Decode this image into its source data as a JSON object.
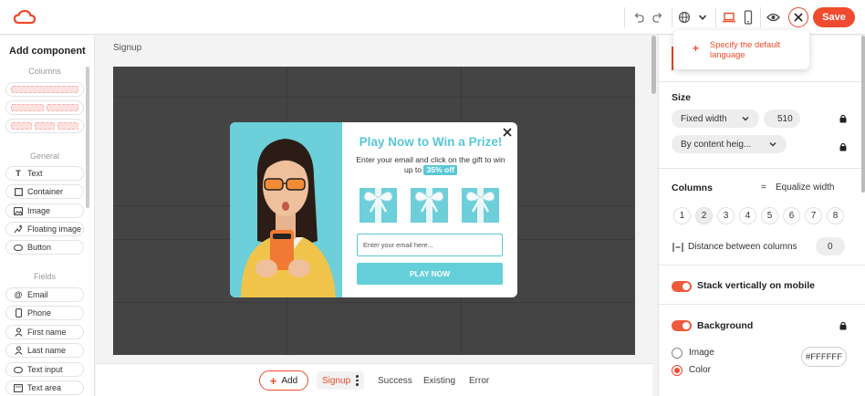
{
  "colors": {
    "accent": "#ef4b2e",
    "popup_accent": "#58c7d6",
    "canvas_bg": "#444444"
  },
  "topbar": {
    "save_label": "Save",
    "icons": [
      "logo-icon",
      "undo-icon",
      "redo-icon",
      "globe-icon",
      "chevron-down-icon",
      "laptop-icon",
      "mobile-icon",
      "eye-icon",
      "close-icon"
    ]
  },
  "language_dropdown": {
    "add_label": "Specify the default language"
  },
  "left_panel": {
    "title": "Add component",
    "sections": {
      "columns": "Columns",
      "general": "General",
      "fields": "Fields"
    },
    "general_items": [
      {
        "label": "Text",
        "icon": "text-icon"
      },
      {
        "label": "Container",
        "icon": "container-icon"
      },
      {
        "label": "Image",
        "icon": "image-icon"
      },
      {
        "label": "Floating image",
        "icon": "floating-image-icon"
      },
      {
        "label": "Button",
        "icon": "button-icon"
      }
    ],
    "field_items": [
      {
        "label": "Email",
        "icon": "at-icon"
      },
      {
        "label": "Phone",
        "icon": "phone-icon"
      },
      {
        "label": "First name",
        "icon": "person-icon"
      },
      {
        "label": "Last name",
        "icon": "person-icon"
      },
      {
        "label": "Text input",
        "icon": "text-input-icon"
      },
      {
        "label": "Text area",
        "icon": "text-area-icon"
      }
    ]
  },
  "canvas": {
    "page_label": "Signup",
    "popup": {
      "title": "Play Now to Win a Prize!",
      "subtitle": "Enter your email and click on the gift to win up to",
      "badge": "35% off",
      "email_placeholder": "Enter your email here...",
      "cta": "PLAY NOW"
    }
  },
  "bottom_bar": {
    "add_label": "Add",
    "pages": [
      "Signup",
      "Success",
      "Existing",
      "Error"
    ],
    "active_page": "Signup"
  },
  "right_panel": {
    "size": {
      "heading": "Size",
      "width_mode": "Fixed width",
      "width_value": "510",
      "height_mode": "By content heig..."
    },
    "columns": {
      "heading": "Columns",
      "equalize": "Equalize width",
      "options": [
        "1",
        "2",
        "3",
        "4",
        "5",
        "6",
        "7",
        "8"
      ],
      "selected": "2",
      "distance_label": "Distance between columns",
      "distance_value": "0"
    },
    "stack_label": "Stack vertically on mobile",
    "background": {
      "heading": "Background",
      "image_label": "Image",
      "color_label": "Color",
      "color_value": "#FFFFFF",
      "selected": "Color"
    }
  }
}
